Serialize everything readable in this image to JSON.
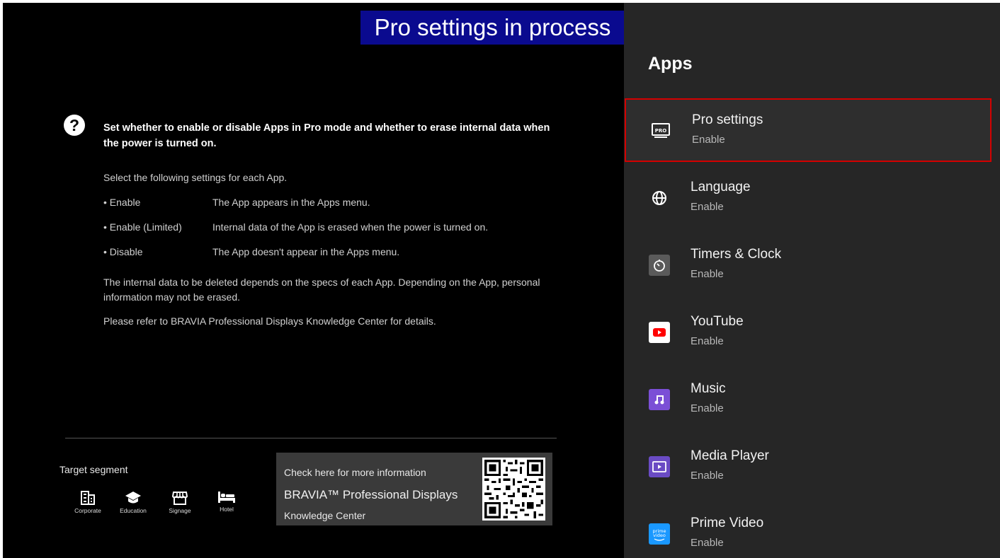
{
  "banner": "Pro settings in process",
  "help": {
    "title": "Set whether to enable or disable Apps in Pro mode and whether to erase internal data when the power is turned on.",
    "intro": "Select the following settings for each App.",
    "options": [
      {
        "key": "• Enable",
        "desc": "The App appears in the Apps menu."
      },
      {
        "key": "• Enable (Limited)",
        "desc": "Internal data of the App is erased when the power is turned on."
      },
      {
        "key": "• Disable",
        "desc": "The App doesn't appear in the Apps menu."
      }
    ],
    "note1": "The internal data to be deleted depends on the specs of each App. Depending on the App, personal information may not be erased.",
    "note2": "Please refer to BRAVIA Professional Displays Knowledge Center for details."
  },
  "target_segment": {
    "label": "Target segment",
    "items": [
      {
        "label": "Corporate",
        "icon": "building-icon"
      },
      {
        "label": "Education",
        "icon": "graduation-cap-icon"
      },
      {
        "label": "Signage",
        "icon": "storefront-icon"
      },
      {
        "label": "Hotel",
        "icon": "bed-icon"
      }
    ]
  },
  "info_box": {
    "line1": "Check here for more information",
    "line2": "BRAVIA™ Professional Displays",
    "line3": "Knowledge Center"
  },
  "panel": {
    "title": "Apps",
    "items": [
      {
        "name": "Pro settings",
        "status": "Enable",
        "icon": "pro-settings-icon",
        "selected": true
      },
      {
        "name": "Language",
        "status": "Enable",
        "icon": "globe-icon"
      },
      {
        "name": "Timers & Clock",
        "status": "Enable",
        "icon": "timer-icon"
      },
      {
        "name": "YouTube",
        "status": "Enable",
        "icon": "youtube-icon"
      },
      {
        "name": "Music",
        "status": "Enable",
        "icon": "music-icon"
      },
      {
        "name": "Media Player",
        "status": "Enable",
        "icon": "media-player-icon"
      },
      {
        "name": "Prime Video",
        "status": "Enable",
        "icon": "prime-video-icon"
      }
    ]
  },
  "colors": {
    "banner_bg": "#0a0a8f",
    "selection_border": "#d40000",
    "youtube_red": "#ff0000",
    "music_purple": "#7b4fd6",
    "media_purple": "#6a4bc4",
    "prime_blue": "#1a98ff"
  }
}
